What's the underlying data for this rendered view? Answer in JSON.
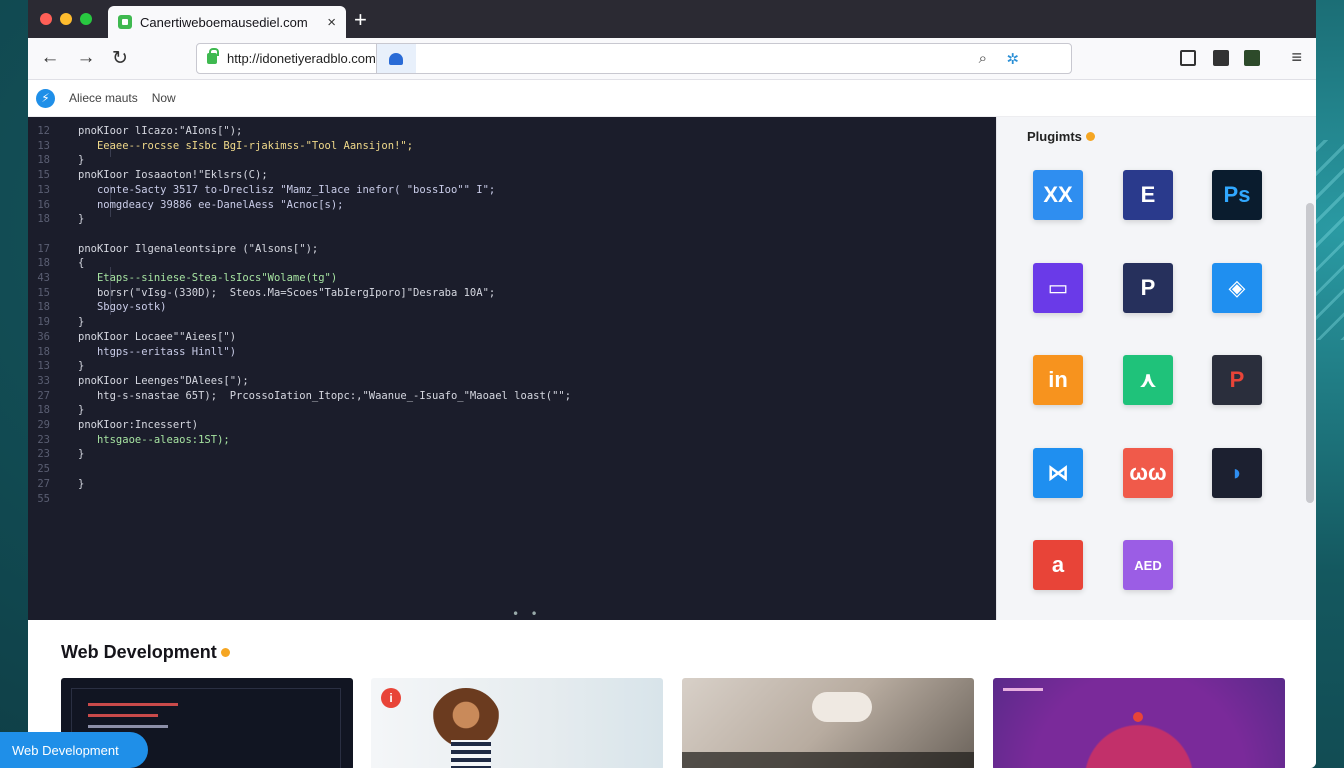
{
  "browser": {
    "tab_title": "Canertiweboemausediel.com",
    "tab_close": "×",
    "new_tab": "+",
    "back": "←",
    "forward": "→",
    "reload": "↻",
    "url": "http://idonetiyeradblo.com",
    "menu": "≡",
    "colors": {
      "close": "#ff5f57",
      "minimize": "#febc2e",
      "maximize": "#28c840"
    }
  },
  "bookmarks": {
    "icon": "⚡",
    "items": [
      "Aliece mauts",
      "Now"
    ]
  },
  "editor": {
    "lines": [
      {
        "n": "12",
        "text": "pnoKIoor lIcazo:\"AIons[\");",
        "color": "#d5d7e0"
      },
      {
        "n": "13",
        "text": "   Eeaee--rocsse sIsbc BgI-rjakimss-\"Tool Aansijon!\";",
        "color": "#f0d98a"
      },
      {
        "n": "18",
        "text": "}",
        "color": "#d5d7e0"
      },
      {
        "n": "15",
        "text": "pnoKIoor Iosaaoton!\"Eklsrs(C);",
        "color": "#d5d7e0"
      },
      {
        "n": "13",
        "text": "   conte-Sacty 3517 to-Dreclisz \"Mamz_Ilace inefor( \"bossIoo\"\" I\";",
        "color": "#c9cce8"
      },
      {
        "n": "16",
        "text": "   nomgdeacy 39886 ee-DanelAess \"Acnoc[s);",
        "color": "#c9cce8"
      },
      {
        "n": "18",
        "text": "}",
        "color": "#d5d7e0"
      },
      {
        "n": "",
        "text": "",
        "color": "#d5d7e0"
      },
      {
        "n": "17",
        "text": "pnoKIoor Ilgenaleontsipre (\"Alsons[\");",
        "color": "#d5d7e0"
      },
      {
        "n": "18",
        "text": "{",
        "color": "#d5d7e0"
      },
      {
        "n": "43",
        "text": "   Etaps--siniese-Stea-lsIocs\"Wolame(tg\")",
        "color": "#a6e3a1"
      },
      {
        "n": "15",
        "text": "   borsr(\"vIsg-(330D);  Steos.Ma=Scoes\"TabIergIporo]\"Desraba 10A\";",
        "color": "#d5d7e0"
      },
      {
        "n": "18",
        "text": "   Sbgoy-sotk)",
        "color": "#c9cce8"
      },
      {
        "n": "19",
        "text": "}",
        "color": "#d5d7e0"
      },
      {
        "n": "36",
        "text": "pnoKIoor Locaee\"\"Aiees[\")",
        "color": "#d5d7e0"
      },
      {
        "n": "18",
        "text": "   htgps--eritass Hinll\")",
        "color": "#c9cce8"
      },
      {
        "n": "13",
        "text": "}",
        "color": "#d5d7e0"
      },
      {
        "n": "33",
        "text": "pnoKIoor Leenges\"DAlees[\");",
        "color": "#d5d7e0"
      },
      {
        "n": "27",
        "text": "   htg-s-snastae 65T);  PrcossoIation_Itopc:,\"Waanue_-Isuafo_\"Maoael loast(\"\";",
        "color": "#d5d7e0"
      },
      {
        "n": "18",
        "text": "}",
        "color": "#d5d7e0"
      },
      {
        "n": "29",
        "text": "pnoKIoor:Incessert)",
        "color": "#d5d7e0"
      },
      {
        "n": "23",
        "text": "   htsgaoe--aleaos:1ST);",
        "color": "#a6e3a1"
      },
      {
        "n": "23",
        "text": "}",
        "color": "#d5d7e0"
      },
      {
        "n": "25",
        "text": "",
        "color": "#d5d7e0"
      },
      {
        "n": "27",
        "text": "}",
        "color": "#d5d7e0"
      },
      {
        "n": "55",
        "text": "",
        "color": "#d5d7e0"
      }
    ],
    "dots": "• •"
  },
  "plugins": {
    "title": "Plugimts",
    "tiles": [
      {
        "label": "XX",
        "bg": "#2f8ef0",
        "icon": "xx-icon"
      },
      {
        "label": "E",
        "bg": "#2a3a8c",
        "icon": "e-icon"
      },
      {
        "label": "Ps",
        "bg": "#0a1c2e",
        "fg": "#31a8ff",
        "icon": "photoshop-icon"
      },
      {
        "label": "▭",
        "bg": "#6a3ae8",
        "icon": "purple-box-icon"
      },
      {
        "label": "P",
        "bg": "#26305c",
        "icon": "p-icon"
      },
      {
        "label": "◈",
        "bg": "#1f8ff0",
        "icon": "shield-icon"
      },
      {
        "label": "in",
        "bg": "#f7931e",
        "icon": "in-icon"
      },
      {
        "label": "⋏",
        "bg": "#1fc27a",
        "icon": "green-tree-icon"
      },
      {
        "label": "P",
        "bg": "#2a2e3c",
        "fg": "#e84438",
        "icon": "red-p-icon"
      },
      {
        "label": "⋈",
        "bg": "#1f8ff0",
        "icon": "bowtie-icon"
      },
      {
        "label": "ωω",
        "bg": "#f05a4a",
        "icon": "ww-icon"
      },
      {
        "label": "◗",
        "bg": "#1c2030",
        "fg": "#2f8ef0",
        "icon": "blue-blob-icon"
      },
      {
        "label": "a",
        "bg": "#e84438",
        "icon": "a-icon"
      },
      {
        "label": "AED",
        "bg": "#9b5de5",
        "icon": "aed-icon"
      }
    ]
  },
  "bottom": {
    "section_title": "Web Development",
    "badge": "i",
    "chip_label": "Web Development"
  }
}
